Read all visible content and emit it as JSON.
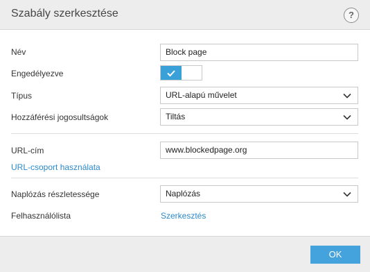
{
  "dialog": {
    "title": "Szabály szerkesztése",
    "help_symbol": "?"
  },
  "form": {
    "name_label": "Név",
    "name_value": "Block page",
    "enabled_label": "Engedélyezve",
    "enabled": true,
    "type_label": "Típus",
    "type_value": "URL-alapú művelet",
    "access_label": "Hozzáférési jogosultságok",
    "access_value": "Tiltás",
    "url_label": "URL-cím",
    "url_value": "www.blockedpage.org",
    "url_group_link": "URL-csoport használata",
    "log_label": "Naplózás részletessége",
    "log_value": "Naplózás",
    "userlist_label": "Felhasználólista",
    "userlist_link": "Szerkesztés"
  },
  "footer": {
    "ok_label": "OK"
  },
  "colors": {
    "accent": "#44a3dc",
    "link": "#2a88c8",
    "header_bg": "#ededed"
  },
  "icons": {
    "help": "question-circle-icon",
    "toggle_check": "checkmark-icon",
    "dropdown": "chevron-down-icon"
  }
}
